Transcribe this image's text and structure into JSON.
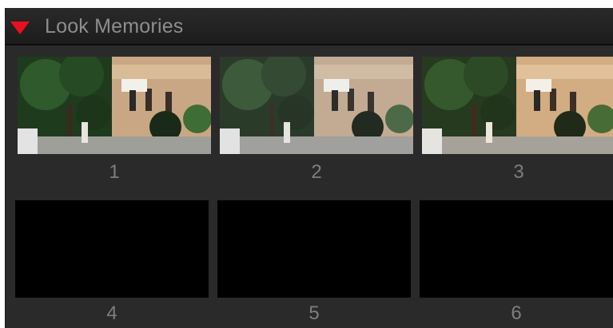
{
  "panel": {
    "title": "Look Memories",
    "collapse_icon": "triangle-down-icon",
    "accent_color": "#e8101e"
  },
  "memories": [
    {
      "label": "1",
      "has_thumbnail": true,
      "tone": "normal"
    },
    {
      "label": "2",
      "has_thumbnail": true,
      "tone": "desaturated"
    },
    {
      "label": "3",
      "has_thumbnail": true,
      "tone": "warm"
    },
    {
      "label": "4",
      "has_thumbnail": false
    },
    {
      "label": "5",
      "has_thumbnail": false
    },
    {
      "label": "6",
      "has_thumbnail": false
    }
  ]
}
